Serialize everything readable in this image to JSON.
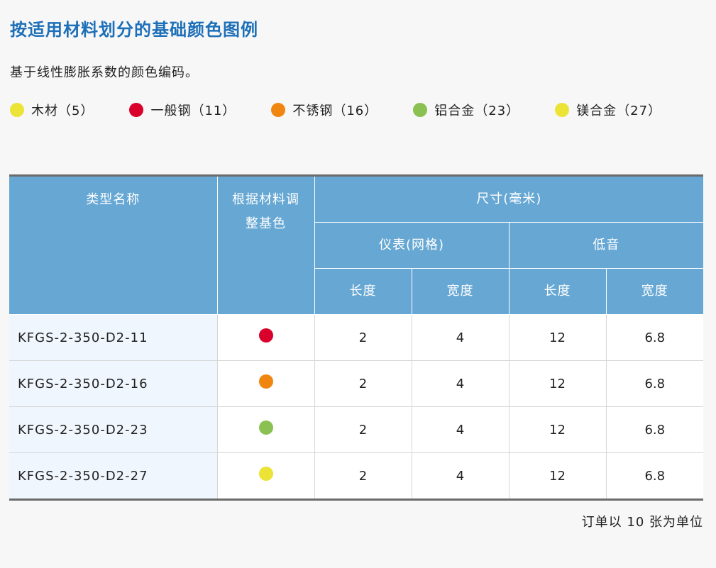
{
  "title": "按适用材料划分的基础颜色图例",
  "subtitle": "基于线性膨胀系数的颜色编码。",
  "legend": [
    {
      "label": "木材（5）",
      "color": "#ece337"
    },
    {
      "label": "一般钢（11）",
      "color": "#d9002c"
    },
    {
      "label": "不锈钢（16）",
      "color": "#f08610"
    },
    {
      "label": "铝合金（23）",
      "color": "#8ac152"
    },
    {
      "label": "镁合金（27）",
      "color": "#ece337"
    }
  ],
  "table": {
    "headers": {
      "type_name": "类型名称",
      "base_color": "根据材料调整基色",
      "dimensions": "尺寸(毫米)",
      "meter": "仪表(网格)",
      "bass": "低音",
      "length": "长度",
      "width": "宽度"
    },
    "rows": [
      {
        "name": "KFGS-2-350-D2-11",
        "color": "#d9002c",
        "meter_length": "2",
        "meter_width": "4",
        "bass_length": "12",
        "bass_width": "6.8"
      },
      {
        "name": "KFGS-2-350-D2-16",
        "color": "#f08610",
        "meter_length": "2",
        "meter_width": "4",
        "bass_length": "12",
        "bass_width": "6.8"
      },
      {
        "name": "KFGS-2-350-D2-23",
        "color": "#8ac152",
        "meter_length": "2",
        "meter_width": "4",
        "bass_length": "12",
        "bass_width": "6.8"
      },
      {
        "name": "KFGS-2-350-D2-27",
        "color": "#ece337",
        "meter_length": "2",
        "meter_width": "4",
        "bass_length": "12",
        "bass_width": "6.8"
      }
    ]
  },
  "note": "订单以 10 张为单位"
}
